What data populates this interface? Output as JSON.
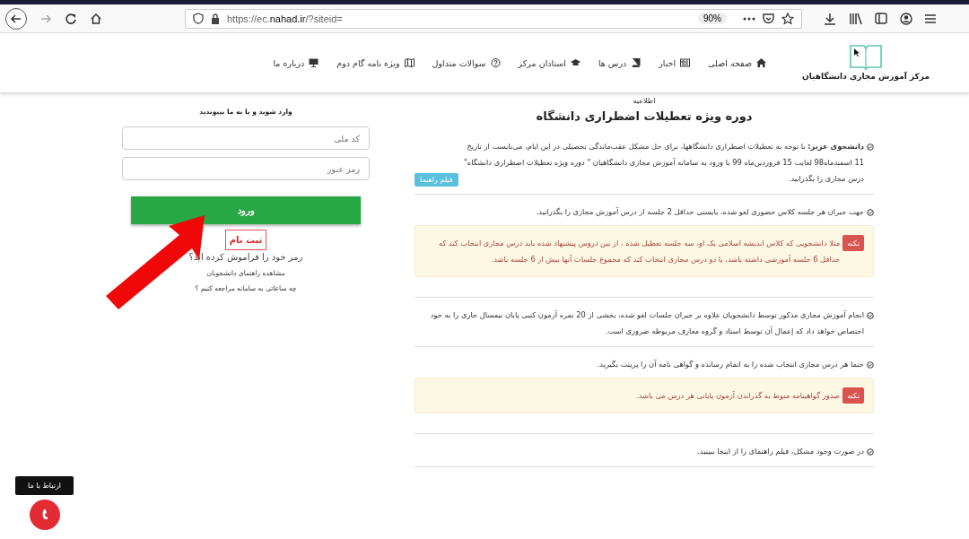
{
  "browser": {
    "url_host": "https://ec.",
    "url_domain": "nahad.ir",
    "url_path": "/?siteid=",
    "zoom": "90%"
  },
  "header": {
    "logo_text": "مرکز آموزش مجازی دانشگاهیان",
    "nav": [
      {
        "label": "صفحه اصلی"
      },
      {
        "label": "اخبار"
      },
      {
        "label": "درس ها"
      },
      {
        "label": "استادان مرکز"
      },
      {
        "label": "سوالات متداول"
      },
      {
        "label": "ویژه نامه گام دوم"
      },
      {
        "label": "درباره ما"
      }
    ]
  },
  "notice": {
    "kicker": "اطلاعیه",
    "title": "دوره ویژه تعطیلات اضطراری دانشگاه",
    "sections": [
      {
        "text": "**دانشجوی عزیز:** با توجه به تعطیلات اضطراری دانشگاهها، برای حل مشکل عقب‌ماندگی تحصیلی در این ایام، می‌بایست از تاریخ 11 اسفندماه98 لغایت 15 فروردین‌ماه 99 با ورود به سامانه آموزش مجازی دانشگاهیان \" دوره ویژه تعطیلات اضطراری دانشگاه\" درس مجازی را بگذرانید.",
        "button": "فیلم راهنما"
      },
      {
        "text": "جهت جبران هر جلسه کلاس حضوری لغو شده، بایستی حداقل 2 جلسه از درس آموزش مجازی را بگذرانید.",
        "note_label": "نکته",
        "note": "مثلا دانشجویی که کلاس اندیشه اسلامی یک او، سه جلسه تعطیل شده ، از بین دروس پیشنهاد شده باید درس مجازی انتخاب کند که حداقل 6 جلسه آموزشی داشته باشد، یا دو درس مجازی انتخاب کند که مجموع جلسات آنها بیش از 6 جلسه باشد."
      },
      {
        "text": "انجام آموزش مجازی مذکور توسط دانشجویان علاوه بر جبران جلسات لغو شده، بخشی از 20 نمره آزمون کتبی پایان نیمسال جاری را به خود اختصاص خواهد داد که إعمال آن توسط استاد و گروه معارف مربوطه ضروری است."
      },
      {
        "text": "حتما هر درس مجازی انتخاب شده را به اتمام رسانده و گواهی نامه آن را پرینت بگیرید.",
        "note_label": "نکته",
        "note": "صدور گواهینامه منوط به گذراندن آزمون پایانی هر درس می باشد."
      },
      {
        "text": "در صورت وجود مشکل، فیلم راهنمای را از اینجا ببینید."
      }
    ]
  },
  "login": {
    "heading": "وارد شوید و یا به ما بپیوندید",
    "id_placeholder": "کد ملی",
    "password_placeholder": "رمز عبور",
    "submit": "ورود",
    "register": "ثبت نام",
    "forgot": "رمز خود را فراموش کرده اید؟",
    "guide": "مشاهده راهنمای دانشجویان",
    "hours": "چه ساعاتی به سامانه مراجعه کنیم ؟"
  },
  "contact": {
    "tooltip": "ارتباط با ما"
  }
}
